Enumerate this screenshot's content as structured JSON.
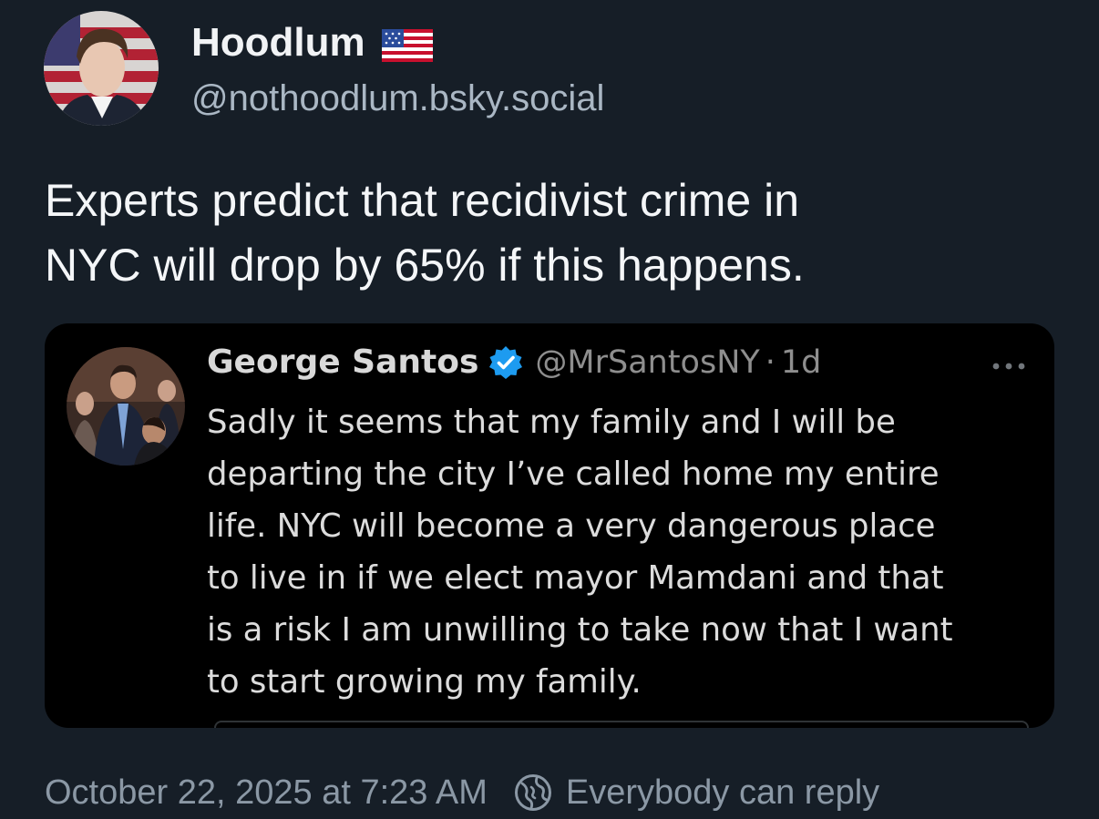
{
  "author": {
    "display_name": "Hoodlum",
    "flag_icon": "us-flag-icon",
    "handle": "@nothoodlum.bsky.social"
  },
  "post": {
    "text": "Experts predict that recidivist crime in\nNYC will drop by 65% if this happens."
  },
  "quote": {
    "display_name": "George Santos",
    "verified_icon": "verified-badge-icon",
    "handle": "@MrSantosNY",
    "separator": "·",
    "time": "1d",
    "more_icon": "more-options-icon",
    "text": "Sadly it seems that my family and I will be\ndeparting the city I’ve called home my entire\nlife. NYC will become a very dangerous place\nto live in if we elect mayor Mamdani and that\nis a risk I am unwilling to take now that I want\nto start growing my family."
  },
  "footer": {
    "timestamp": "October 22, 2025 at 7:23 AM",
    "reply_icon": "globe-icon",
    "reply_setting": "Everybody can reply"
  },
  "colors": {
    "background": "#161e27",
    "card_background": "#000000",
    "verified_blue": "#1d9bf0",
    "muted_text": "#8b98a5"
  }
}
